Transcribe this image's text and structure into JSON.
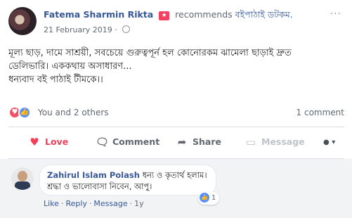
{
  "post": {
    "author": "Fatema Sharmin Rikta",
    "action_text": "recommends",
    "page_name": "বইপাঠাই ডটকম.",
    "date": "21 February 2019",
    "date_separator": "·",
    "body_lines": [
      "মূল্য ছাড়, দামে সাশ্রয়ী, সবচেয়ে গুরুত্বপূর্ন হল কোনোরকম ঝামেলা ছাড়াই দ্রুত",
      "ডেলিভারি। এককথায় অসাধারণ...",
      "ধন্যবাদ বই পাঠাই টীমকে।।"
    ]
  },
  "stats": {
    "reactions_text": "You and 2 others",
    "comments_text": "1 comment"
  },
  "actions": {
    "love": "Love",
    "comment": "Comment",
    "share": "Share",
    "message": "Message"
  },
  "comment": {
    "author": "Zahirul Islam Polash",
    "text_line1": "ধন্য ও কৃতার্থ হলাম।",
    "text_line2": "শ্রদ্ধা ও ভালোবাসা নিবেন, আপু।",
    "reaction_count": "1",
    "like": "Like",
    "reply": "Reply",
    "message": "Message",
    "time": "1y"
  },
  "icons": {
    "love_color": "#f33e58",
    "like_color": "#5890ff",
    "link_color": "#365899"
  }
}
